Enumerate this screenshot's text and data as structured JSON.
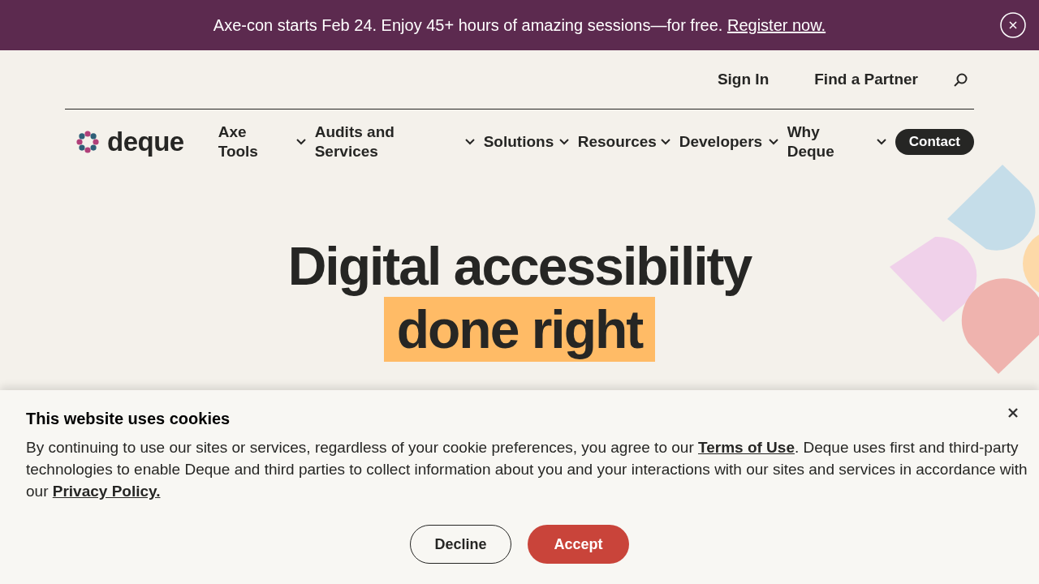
{
  "announcement": {
    "text": "Axe-con starts Feb 24. Enjoy 45+ hours of amazing sessions—for free.",
    "link": "Register now."
  },
  "utility_nav": [
    "Sign In",
    "Find a Partner"
  ],
  "logo": {
    "text": "deque"
  },
  "main_nav": [
    {
      "label": "Axe Tools",
      "kind": "dropdown"
    },
    {
      "label": "Audits and Services",
      "kind": "dropdown"
    },
    {
      "label": "Solutions",
      "kind": "dropdown"
    },
    {
      "label": "Resources",
      "kind": "dropdown"
    },
    {
      "label": "Developers",
      "kind": "dropdown"
    },
    {
      "label": "Why Deque",
      "kind": "dropdown"
    },
    {
      "label": "Contact",
      "kind": "button"
    }
  ],
  "hero": {
    "title": "Digital accessibility",
    "highlight": "done right"
  },
  "cookie_banner": {
    "title": "This website uses cookies",
    "text_before": "By continuing to use our sites or services, regardless of your cookie preferences, you agree to our ",
    "terms_link": "Terms of Use",
    "text_middle": ". Deque uses first and third-party technologies to enable Deque and third parties to collect information about you and your interactions with our sites and services in accordance with our ",
    "privacy_link": "Privacy Policy.",
    "buttons": [
      {
        "label": "Decline",
        "kind": "secondary"
      },
      {
        "label": "Accept",
        "kind": "primary"
      }
    ]
  }
}
